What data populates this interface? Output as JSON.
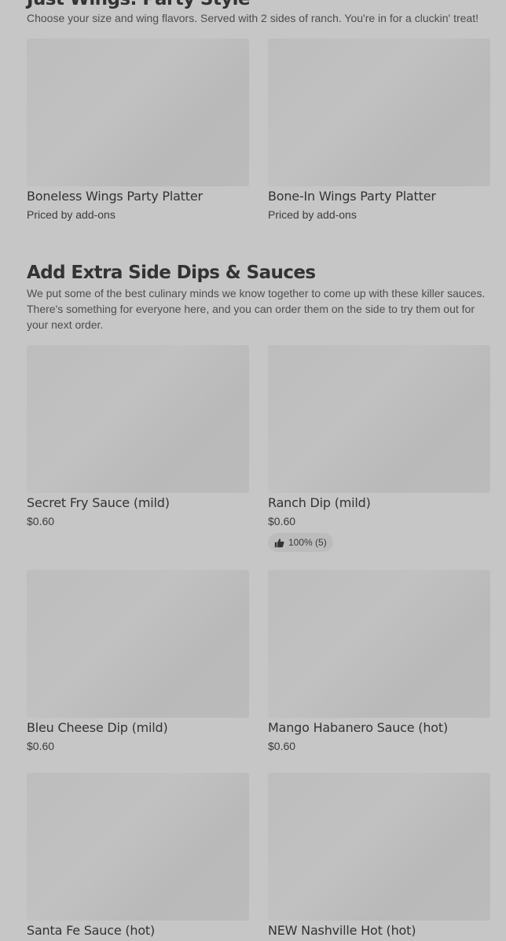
{
  "sections": [
    {
      "title": "Just Wings: Party Style",
      "description": "Choose your size and wing flavors. Served with 2 sides of ranch. You're in for a cluckin' treat!",
      "items": [
        {
          "name": "Boneless Wings Party Platter",
          "price": "Priced by add-ons"
        },
        {
          "name": "Bone-In Wings Party Platter",
          "price": "Priced by add-ons"
        }
      ]
    },
    {
      "title": "Add Extra Side Dips & Sauces",
      "description": "We put some of the best culinary minds we know together to come up with these killer sauces. There's something for everyone here, and you can order them on the side to try them out for your next order.",
      "items": [
        {
          "name": "Secret Fry Sauce (mild)",
          "price": "$0.60"
        },
        {
          "name": "Ranch Dip (mild)",
          "price": "$0.60",
          "rating": "100% (5)",
          "rating_icon": "thumbs-up-icon"
        },
        {
          "name": "Bleu Cheese Dip (mild)",
          "price": "$0.60"
        },
        {
          "name": "Mango Habanero Sauce (hot)",
          "price": "$0.60"
        },
        {
          "name": "Santa Fe Sauce (hot)",
          "price": ""
        },
        {
          "name": "NEW Nashville Hot (hot)",
          "price": ""
        }
      ]
    }
  ]
}
